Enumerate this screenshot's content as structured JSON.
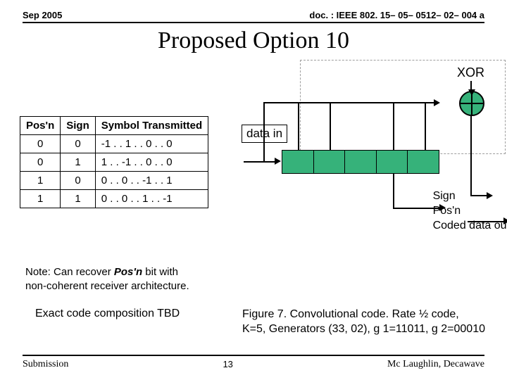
{
  "header": {
    "date": "Sep 2005",
    "doc": "doc. : IEEE 802. 15– 05– 0512– 02– 004 a"
  },
  "title": "Proposed Option 10",
  "xor_label": "XOR",
  "table": {
    "headers": {
      "posn": "Pos'n",
      "sign": "Sign",
      "symbol": "Symbol Transmitted"
    },
    "rows": [
      {
        "posn": "0",
        "sign": "0",
        "symbol": "-1 . .  1 . .  0 . .  0"
      },
      {
        "posn": "0",
        "sign": "1",
        "symbol": " 1 . . -1 . .  0 . .  0"
      },
      {
        "posn": "1",
        "sign": "0",
        "symbol": " 0 . .  0 . . -1 . .  1"
      },
      {
        "posn": "1",
        "sign": "1",
        "symbol": " 0 . .  0 . .  1 . . -1"
      }
    ]
  },
  "note": {
    "line1a": "Note: Can recover ",
    "line1b": "Pos'n",
    "line1c": " bit with",
    "line2": "non-coherent receiver architecture."
  },
  "tbd": "Exact code composition TBD",
  "datain": "data in",
  "signals": {
    "sign": "Sign",
    "posn": "Pos'n",
    "out": "Coded data out"
  },
  "figure": {
    "line1": "Figure 7. Convolutional code. Rate ½ code,",
    "line2": "K=5, Generators (33, 02), g 1=11011, g 2=00010"
  },
  "footer": {
    "left": "Submission",
    "center": "13",
    "right": "Mc Laughlin, Decawave"
  }
}
